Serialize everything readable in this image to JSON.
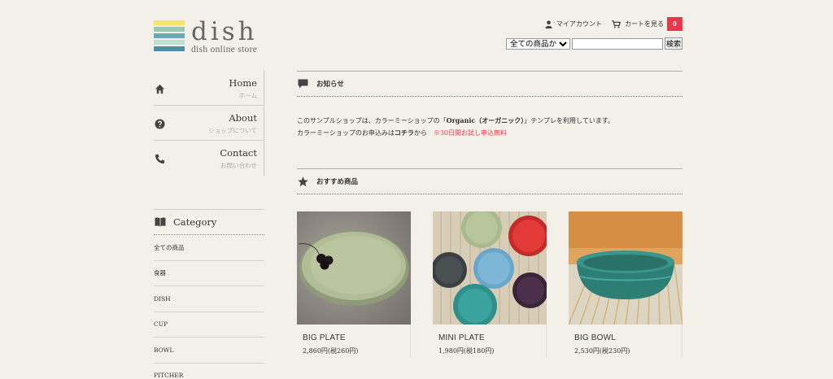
{
  "brand": {
    "title": "dish",
    "subtitle": "dish online store",
    "stripe_colors": [
      "#f7e56b",
      "#96c8b2",
      "#6ca6b8",
      "#bfe0d4",
      "#4e8ea6"
    ]
  },
  "header": {
    "account_label": "マイアカウント",
    "cart_label": "カートを見る",
    "cart_count": "0"
  },
  "search": {
    "select_value": "全ての商品から",
    "input_value": "",
    "button_label": "検索"
  },
  "nav": {
    "items": [
      {
        "en": "Home",
        "jp": "ホーム",
        "icon": "home-icon"
      },
      {
        "en": "About",
        "jp": "ショップについて",
        "icon": "help-circle-icon"
      },
      {
        "en": "Contact",
        "jp": "お問い合わせ",
        "icon": "phone-icon"
      }
    ]
  },
  "category": {
    "title": "Category",
    "items": [
      "全ての商品",
      "食器",
      "DISH",
      "CUP",
      "BOWL",
      "PITCHER"
    ]
  },
  "notice": {
    "title": "お知らせ",
    "line1_pre": "このサンプルショップは、カラーミーショップの「",
    "line1_bold": "Organic（オーガニック）",
    "line1_post": "」テンプレを利用しています。",
    "line2_pre": "カラーミーショップのお申込みは",
    "line2_bold": "コチラ",
    "line2_post": "から　",
    "line2_red": "※30日間お試し申込無料"
  },
  "recommend": {
    "title": "おすすめ商品",
    "products": [
      {
        "name": "BIG PLATE",
        "price": "2,860円(税260円)"
      },
      {
        "name": "MINI PLATE",
        "price": "1,980円(税180円)"
      },
      {
        "name": "BIG BOWL",
        "price": "2,530円(税230円)"
      }
    ]
  },
  "colors": {
    "background": "#f3f0ea",
    "accent_red": "#e8394a"
  }
}
